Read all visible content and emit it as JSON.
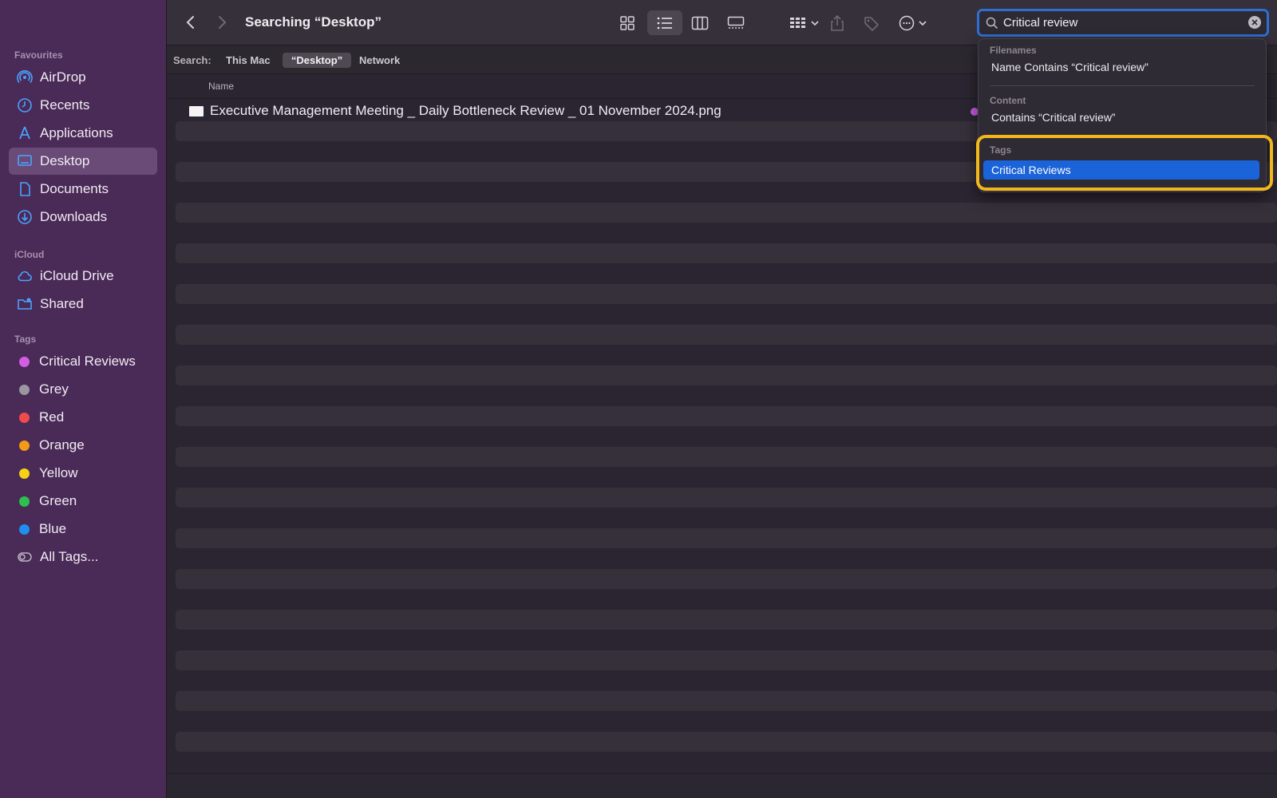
{
  "sidebar": {
    "sections": {
      "favourites": "Favourites",
      "icloud": "iCloud",
      "tags": "Tags"
    },
    "favourites": [
      {
        "label": "AirDrop",
        "icon": "airdrop-icon"
      },
      {
        "label": "Recents",
        "icon": "clock-icon"
      },
      {
        "label": "Applications",
        "icon": "applications-icon"
      },
      {
        "label": "Desktop",
        "icon": "desktop-icon",
        "selected": true
      },
      {
        "label": "Documents",
        "icon": "document-icon"
      },
      {
        "label": "Downloads",
        "icon": "download-icon"
      }
    ],
    "icloud": [
      {
        "label": "iCloud Drive",
        "icon": "cloud-icon"
      },
      {
        "label": "Shared",
        "icon": "shared-folder-icon"
      }
    ],
    "tags": [
      {
        "label": "Critical Reviews",
        "color": "#d35ee6"
      },
      {
        "label": "Grey",
        "color": "#9a97a0"
      },
      {
        "label": "Red",
        "color": "#ef4b4b"
      },
      {
        "label": "Orange",
        "color": "#f59a16"
      },
      {
        "label": "Yellow",
        "color": "#f5d214"
      },
      {
        "label": "Green",
        "color": "#2fbf4e"
      },
      {
        "label": "Blue",
        "color": "#1f8ef1"
      },
      {
        "label": "All Tags...",
        "icon": "all-tags-icon"
      }
    ]
  },
  "toolbar": {
    "title": "Searching “Desktop”",
    "search_value": "Critical review"
  },
  "scope": {
    "label": "Search:",
    "this_mac": "This Mac",
    "desktop": "“Desktop”",
    "network": "Network"
  },
  "columns": {
    "name": "Name"
  },
  "results": [
    {
      "name": "Executive Management Meeting _ Daily Bottleneck Review _ 01 November 2024.png",
      "tag_color": "#c25be0"
    }
  ],
  "dropdown": {
    "filenames_header": "Filenames",
    "filenames_item": "Name Contains “Critical review”",
    "content_header": "Content",
    "content_item": "Contains “Critical review”",
    "tags_header": "Tags",
    "tags_item": "Critical Reviews"
  },
  "colors": {
    "sidebar_bg": "#4a2a57",
    "accent": "#1b63d8",
    "highlight": "#f2b71a"
  }
}
